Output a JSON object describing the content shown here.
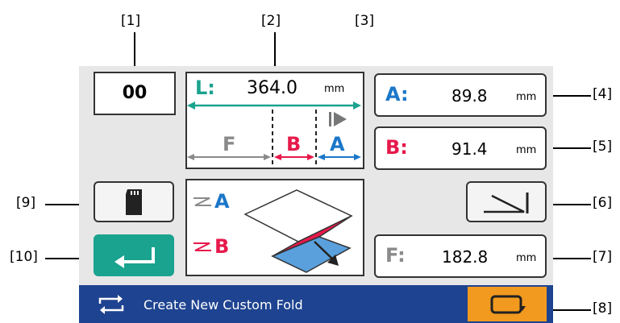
{
  "callouts": [
    "[1]",
    "[2]",
    "[3]",
    "[4]",
    "[5]",
    "[6]",
    "[7]",
    "[8]",
    "[9]",
    "[10]"
  ],
  "counter": "00",
  "length": {
    "label": "L:",
    "value": "364.0",
    "unit": "mm"
  },
  "diagram_labels": {
    "f": "F",
    "b": "B",
    "a": "A"
  },
  "fold_preview": {
    "a": "A",
    "b": "B"
  },
  "measure_a": {
    "label": "A:",
    "value": "89.8",
    "unit": "mm"
  },
  "measure_b": {
    "label": "B:",
    "value": "91.4",
    "unit": "mm"
  },
  "measure_f": {
    "label": "F:",
    "value": "182.8",
    "unit": "mm"
  },
  "status_bar": {
    "text": "Create New Custom Fold"
  },
  "colors": {
    "teal": "#1aa38f",
    "red": "#e6194b",
    "blue": "#1b77c9",
    "navy": "#1e4390",
    "orange": "#f29a1f",
    "gray": "#8a8a8a"
  },
  "icons": [
    "sd-card-icon",
    "enter-icon",
    "fold-direction-icon",
    "refresh-icon",
    "card-rotate-icon",
    "play-step-icon"
  ]
}
